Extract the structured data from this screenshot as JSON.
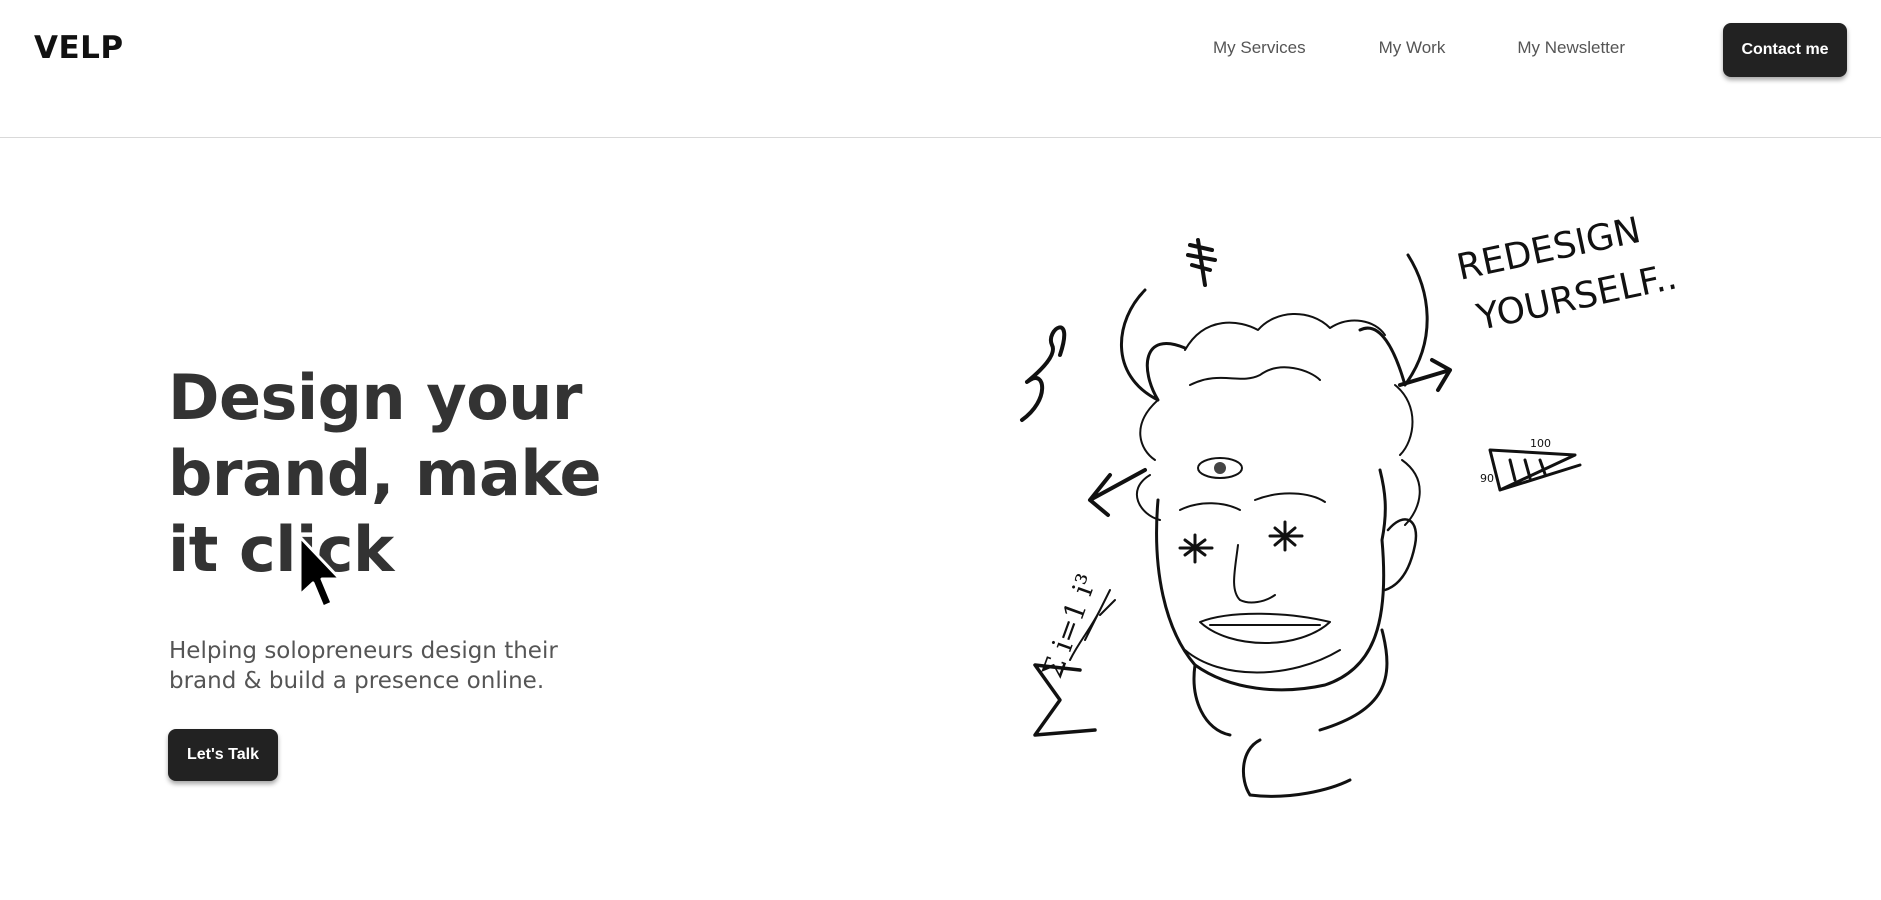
{
  "header": {
    "logo": "VELP",
    "nav": [
      {
        "label": "My Services"
      },
      {
        "label": "My Work"
      },
      {
        "label": "My Newsletter"
      }
    ],
    "contact_label": "Contact me"
  },
  "hero": {
    "title": "Design your brand, make it click",
    "subtitle": "Helping solopreneurs design their brand & build a presence online.",
    "cta_label": "Let's Talk"
  },
  "illustration": {
    "handwritten_text_line1": "REDESIGN",
    "handwritten_text_line2": "YOURSELF..",
    "triangle_label_top": "100",
    "triangle_label_side": "90",
    "formula": "Σ i=1 i³"
  },
  "colors": {
    "button_bg": "#222222",
    "button_text": "#ffffff",
    "text_primary": "#333333",
    "text_secondary": "#555555",
    "divider": "#d9d9d9"
  }
}
